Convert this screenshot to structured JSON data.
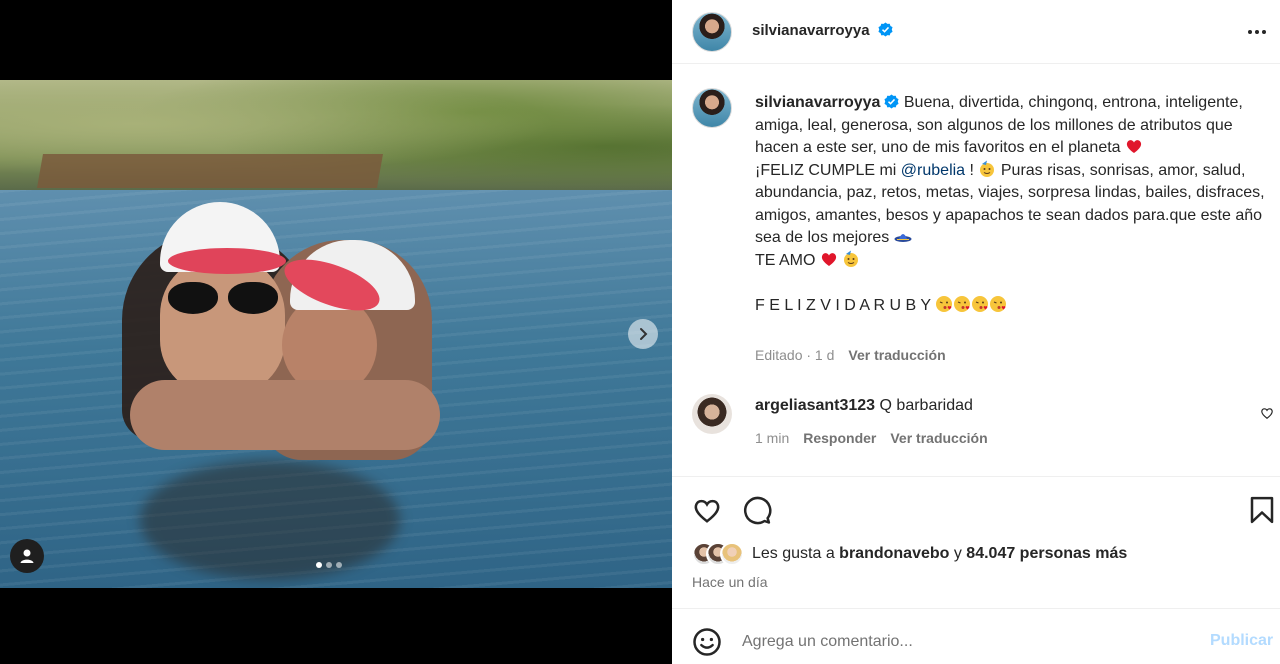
{
  "post": {
    "username": "silvianavarroyya",
    "verified": true,
    "carousel": {
      "slide_count": 3,
      "active_slide": 1
    }
  },
  "caption": {
    "username": "silvianavarroyya",
    "line1": "Buena, divertida, chingonq, entrona, inteligente, amiga, leal, generosa, son algunos de los millones de atributos que hacen a este ser, uno de mis favoritos en el planeta ",
    "line2_pre": "¡FELIZ CUMPLE mi ",
    "mention": "@rubelia",
    "line2_post": " ! ",
    "line3": " Puras risas, sonrisas, amor, salud, abundancia, paz, retos, metas, viajes, sorpresa lindas, bailes, disfraces, amigos, amantes, besos y apapachos te sean dados para.que este año sea de los mejores ",
    "line4": "TE AMO ",
    "line5": "F E L I Z V I D A R U B Y ",
    "edited": "Editado · 1 d",
    "see_translation": "Ver traducción"
  },
  "comment": {
    "username": "argeliasant3123",
    "text": "Q barbaridad",
    "time": "1 min",
    "reply": "Responder",
    "see_translation": "Ver traducción"
  },
  "likes": {
    "prefix": "Les gusta a ",
    "first_liker": "brandonavebo",
    "middle": " y ",
    "count_text": "84.047 personas más",
    "time_ago": "Hace un día"
  },
  "composer": {
    "placeholder": "Agrega un comentario...",
    "publish_label": "Publicar"
  },
  "colors": {
    "verified": "#0095f6",
    "mention": "#00376b",
    "publish_disabled": "#b3dbff",
    "muted": "#737373"
  },
  "icons": [
    "verified-badge-icon",
    "more-options-icon",
    "heart-icon",
    "comment-icon",
    "bookmark-icon",
    "emoji-icon",
    "chevron-right-icon",
    "user-tag-icon",
    "red-heart-emoji",
    "party-face-emoji",
    "kiss-emoji",
    "sombrero-emoji"
  ]
}
